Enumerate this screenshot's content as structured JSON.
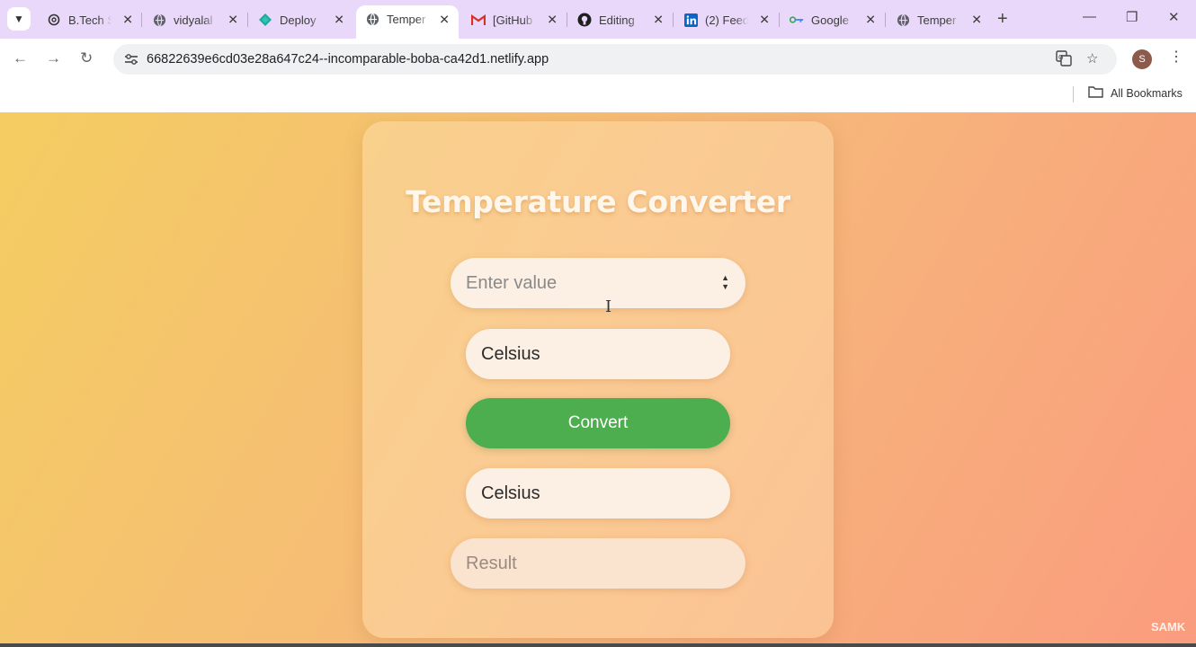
{
  "browser": {
    "tabs": [
      {
        "label": "B.Tech S",
        "icon": "openai-icon"
      },
      {
        "label": "vidyalal",
        "icon": "globe-icon"
      },
      {
        "label": "Deploy",
        "icon": "netlify-icon"
      },
      {
        "label": "Temper",
        "icon": "globe-icon",
        "active": true
      },
      {
        "label": "[GitHub",
        "icon": "gmail-icon"
      },
      {
        "label": "Editing",
        "icon": "github-icon"
      },
      {
        "label": "(2) Feed",
        "icon": "linkedin-icon"
      },
      {
        "label": "Google",
        "icon": "google-password-icon"
      },
      {
        "label": "Temper",
        "icon": "globe-icon"
      }
    ],
    "url": "66822639e6cd03e28a647c24--incomparable-boba-ca42d1.netlify.app",
    "profile_initial": "S",
    "bookmarks_label": "All Bookmarks"
  },
  "app": {
    "title": "Temperature Converter",
    "input_placeholder": "Enter value",
    "from_unit": "Celsius",
    "convert_label": "Convert",
    "to_unit": "Celsius",
    "result_placeholder": "Result"
  },
  "watermark": "SAMK",
  "colors": {
    "tabstrip": "#e9d8f9",
    "gradient_start": "#f4cd61",
    "gradient_end": "#fa9c7e",
    "convert_button": "#4cae4f",
    "field_bg": "#fcefe3"
  }
}
